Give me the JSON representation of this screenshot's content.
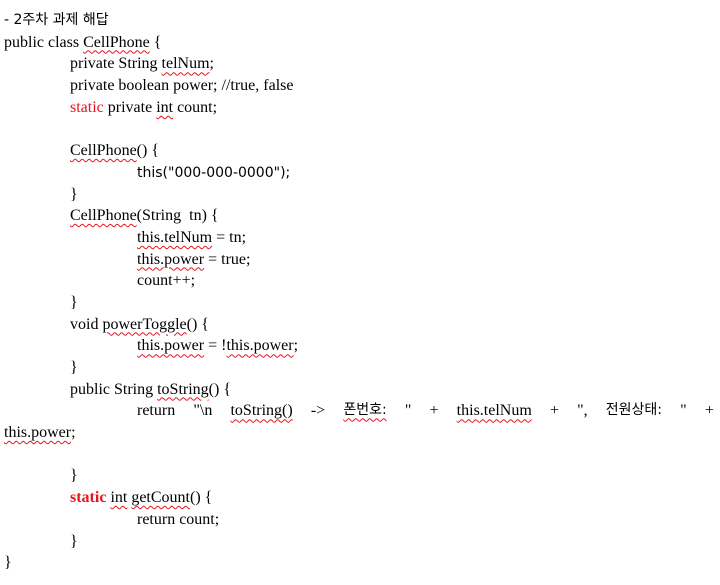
{
  "header": "- 2주차 과제 해답",
  "code": {
    "l1": "public class ",
    "l1_cls": "CellPhone",
    "l1_end": " {",
    "l2_a": "private String ",
    "l2_b": "telNum",
    "l2_c": ";",
    "l3": "private boolean power; //true, false",
    "l4_kw": "static",
    "l4_a": " private ",
    "l4_int": "int",
    "l4_b": " count;",
    "l6_a": "CellPhone",
    "l6_b": "() {",
    "l7": "this(\"000-000-0000\");",
    "l8": "}",
    "l9_a": "CellPhone",
    "l9_b": "(String  tn) {",
    "l10_a": "this.telNum",
    "l10_b": " = tn;",
    "l11_a": "this.power",
    "l11_b": " = true;",
    "l12": "count++;",
    "l13": "}",
    "l14_a": "void ",
    "l14_b": "powerToggle",
    "l14_c": "() {",
    "l15_a": "this.power",
    "l15_b": " = !",
    "l15_c": "this.power",
    "l15_d": ";",
    "l16": "}",
    "l17_a": "public String ",
    "l17_b": "toString",
    "l17_c": "() {",
    "l18_t1": "return",
    "l18_t2": "\"\\n",
    "l18_t3": "toString()",
    "l18_t4": "->",
    "l18_t5": "폰번호:",
    "l18_t6": "\"",
    "l18_t7": "+",
    "l18_t8": "this.telNum",
    "l18_t9": "+",
    "l18_t10": "\",",
    "l18_t11": "전원상태:",
    "l18_t12": "\"",
    "l18_t13": "+",
    "l19_a": "this.power",
    "l19_b": ";",
    "l21": "}",
    "l22_kw": "static",
    "l22_a": " ",
    "l22_int": "int",
    "l22_b": " ",
    "l22_c": "getCount",
    "l22_d": "() {",
    "l23": "return count;",
    "l24": "}",
    "l25": "}"
  }
}
